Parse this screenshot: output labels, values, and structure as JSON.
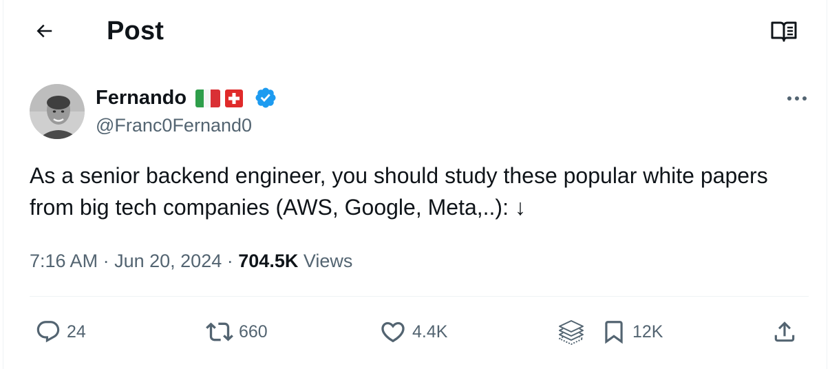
{
  "header": {
    "title": "Post",
    "back_icon": "arrow-left-icon",
    "reader_icon": "open-book-icon"
  },
  "author": {
    "name": "Fernando",
    "handle": "@Franc0Fernand0",
    "flags": [
      "italy-flag-icon",
      "switzerland-flag-icon"
    ],
    "verified_icon": "verified-badge-icon",
    "more_icon": "more-horizontal-icon"
  },
  "post": {
    "text": "As a senior backend engineer, you should study these popular white papers from big tech companies (AWS, Google, Meta,..): ↓",
    "time": "7:16 AM",
    "date": "Jun 20, 2024",
    "separator": "·",
    "views_count": "704.5K",
    "views_label": "Views"
  },
  "actions": {
    "replies": "24",
    "reposts": "660",
    "likes": "4.4K",
    "bookmarks": "12K"
  },
  "colors": {
    "text": "#0f1419",
    "secondary": "#536471",
    "verified": "#1d9bf0",
    "divider": "#eff3f4"
  }
}
